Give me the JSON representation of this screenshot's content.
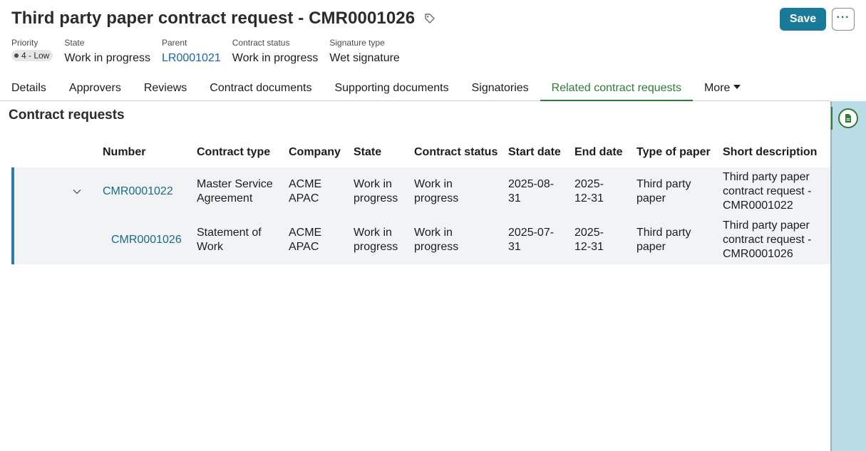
{
  "header": {
    "title": "Third party paper contract request - CMR0001026",
    "save_label": "Save",
    "more_label": "···"
  },
  "meta": {
    "priority": {
      "label": "Priority",
      "value": "4 - Low"
    },
    "state": {
      "label": "State",
      "value": "Work in progress"
    },
    "parent": {
      "label": "Parent",
      "value": "LR0001021"
    },
    "contract_status": {
      "label": "Contract status",
      "value": "Work in progress"
    },
    "signature_type": {
      "label": "Signature type",
      "value": "Wet signature"
    }
  },
  "tabs": [
    {
      "label": "Details"
    },
    {
      "label": "Approvers"
    },
    {
      "label": "Reviews"
    },
    {
      "label": "Contract documents"
    },
    {
      "label": "Supporting documents"
    },
    {
      "label": "Signatories"
    },
    {
      "label": "Related contract requests",
      "active": true
    },
    {
      "label": "More"
    }
  ],
  "section": {
    "title": "Contract requests"
  },
  "table": {
    "columns": [
      "Number",
      "Contract type",
      "Company",
      "State",
      "Contract status",
      "Start date",
      "End date",
      "Type of paper",
      "Short description"
    ],
    "rows": [
      {
        "number": "CMR0001022",
        "contract_type": [
          "Master Service",
          "Agreement"
        ],
        "company": [
          "ACME",
          "APAC"
        ],
        "state": [
          "Work in",
          "progress"
        ],
        "contract_status": [
          "Work in",
          "progress"
        ],
        "start_date": [
          "2025-08-",
          "31"
        ],
        "end_date": [
          "2025-",
          "12-31"
        ],
        "type_of_paper": [
          "Third party",
          "paper"
        ],
        "short_description": [
          "Third party paper",
          "contract request -",
          "CMR0001022"
        ]
      },
      {
        "number": "CMR0001026",
        "contract_type": [
          "Statement of",
          "Work"
        ],
        "company": [
          "ACME",
          "APAC"
        ],
        "state": [
          "Work in",
          "progress"
        ],
        "contract_status": [
          "Work in",
          "progress"
        ],
        "start_date": [
          "2025-07-",
          "31"
        ],
        "end_date": [
          "2025-",
          "12-31"
        ],
        "type_of_paper": [
          "Third party",
          "paper"
        ],
        "short_description": [
          "Third party paper",
          "contract request -",
          "CMR0001026"
        ]
      }
    ]
  },
  "icons": {
    "tag": "tag-icon",
    "row_toggle": "chevron-down-icon",
    "side_panel": "document-icon"
  },
  "colors": {
    "save_button": "#1a7a9a",
    "link": "#1a6a8a",
    "parent_link": "#1c63b0",
    "active_tab": "#2e7d32",
    "side_panel": "#b9dce6",
    "row_accent": "#2e7ca8"
  }
}
